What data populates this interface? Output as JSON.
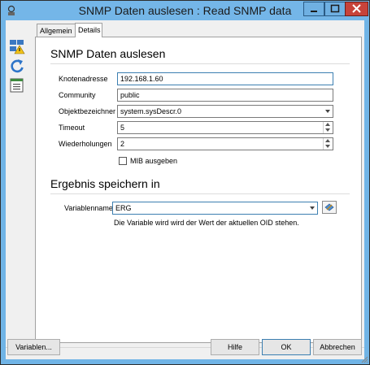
{
  "window": {
    "title": "SNMP Daten auslesen : Read SNMP data"
  },
  "tabs": [
    {
      "label": "Allgemein",
      "active": false
    },
    {
      "label": "Details",
      "active": true
    }
  ],
  "section1": {
    "heading": "SNMP Daten auslesen",
    "fields": {
      "node_label": "Knotenadresse",
      "node_value": "192.168.1.60",
      "community_label": "Community",
      "community_value": "public",
      "oid_label": "Objektbezeichner",
      "oid_value": "system.sysDescr.0",
      "timeout_label": "Timeout",
      "timeout_value": "5",
      "retries_label": "Wiederholungen",
      "retries_value": "2",
      "mib_label": "MIB ausgeben",
      "mib_checked": false
    }
  },
  "section2": {
    "heading": "Ergebnis speichern in",
    "variable_label": "Variablenname",
    "variable_value": "ERG",
    "hint": "Die Variable wird wird der Wert der aktuellen OID stehen."
  },
  "buttons": {
    "variables": "Variablen...",
    "help": "Hilfe",
    "ok": "OK",
    "cancel": "Abbrechen"
  },
  "icons": {
    "app": "wizard-icon",
    "rail_1": "network-warning-icon",
    "rail_2": "refresh-icon",
    "rail_3": "list-document-icon",
    "variable_picker": "variable-picker-icon"
  },
  "colors": {
    "titlebar": "#74b6e8",
    "close_button": "#c7433a",
    "focus_border": "#3c7fb1"
  }
}
